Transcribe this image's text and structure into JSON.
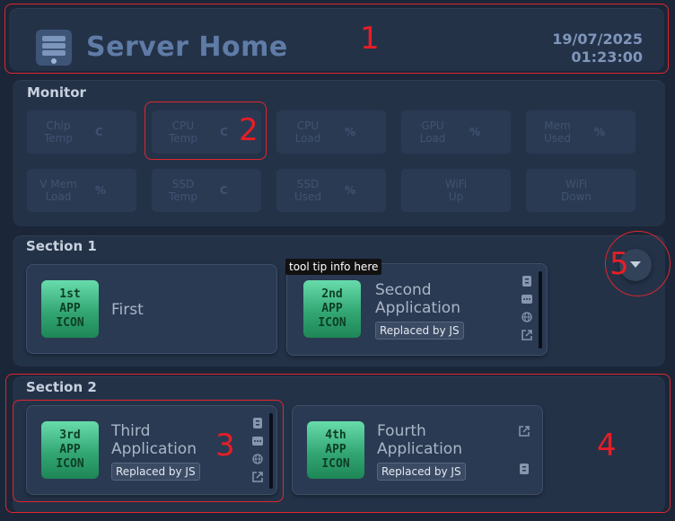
{
  "header": {
    "title": "Server Home",
    "date": "19/07/2025",
    "time": "01:23:00",
    "icon": "server-icon"
  },
  "monitor": {
    "title": "Monitor",
    "tiles": [
      {
        "label": "Chip\nTemp",
        "unit": "C"
      },
      {
        "label": "CPU\nTemp",
        "unit": "C"
      },
      {
        "label": "CPU\nLoad",
        "unit": "%"
      },
      {
        "label": "GPU\nLoad",
        "unit": "%"
      },
      {
        "label": "Mem\nUsed",
        "unit": "%"
      },
      {
        "label": "V Mem\nLoad",
        "unit": "%"
      },
      {
        "label": "SSD\nTemp",
        "unit": "C"
      },
      {
        "label": "SSD\nUsed",
        "unit": "%"
      },
      {
        "label": "WiFi\nUp",
        "unit": ""
      },
      {
        "label": "WiFi\nDown",
        "unit": ""
      }
    ]
  },
  "sections": [
    {
      "title": "Section 1",
      "apps": [
        {
          "icon_text": [
            "1st",
            "APP",
            "ICON"
          ],
          "name": "First",
          "badge": ""
        },
        {
          "icon_text": [
            "2nd",
            "APP",
            "ICON"
          ],
          "name": "Second\nApplication",
          "badge": "Replaced by JS"
        }
      ]
    },
    {
      "title": "Section 2",
      "apps": [
        {
          "icon_text": [
            "3rd",
            "APP",
            "ICON"
          ],
          "name": "Third\nApplication",
          "badge": "Replaced by JS"
        },
        {
          "icon_text": [
            "4th",
            "APP",
            "ICON"
          ],
          "name": "Fourth\nApplication",
          "badge": "Replaced by JS"
        }
      ]
    }
  ],
  "tooltip": "tool tip info here",
  "annotations": [
    "1",
    "2",
    "3",
    "4",
    "5"
  ],
  "colors": {
    "background": "#1b2638",
    "panel": "#243248",
    "accent": "#5f7ca7",
    "annotation": "#e0262e",
    "app_icon": "#33a774"
  }
}
